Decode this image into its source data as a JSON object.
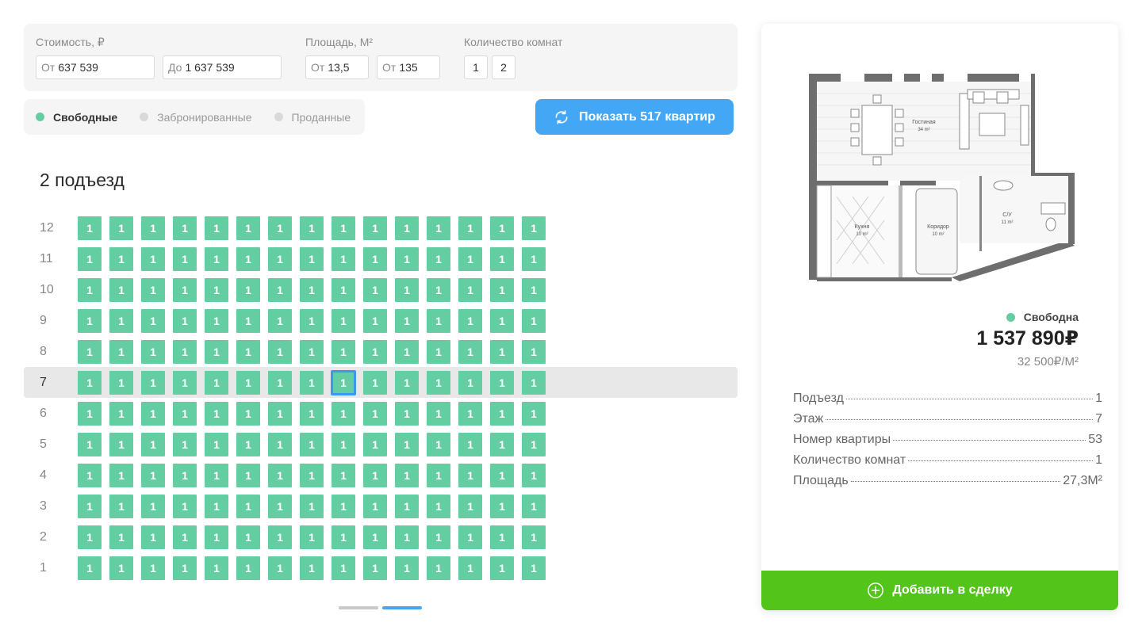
{
  "filters": {
    "price": {
      "label": "Стоимость, ₽",
      "from_prefix": "От",
      "from_value": "637 539",
      "to_prefix": "До",
      "to_value": "1 637 539"
    },
    "area": {
      "label": "Площадь, М²",
      "from_prefix": "От",
      "from_value": "13,5",
      "to_prefix": "От",
      "to_value": "135"
    },
    "rooms": {
      "label": "Количество комнат",
      "options": [
        "1",
        "2"
      ]
    }
  },
  "status_legend": [
    {
      "label": "Свободные",
      "color": "#64cda2",
      "active": true
    },
    {
      "label": "Забронированные",
      "color": "#d9d9d9",
      "active": false
    },
    {
      "label": "Проданные",
      "color": "#d9d9d9",
      "active": false
    }
  ],
  "show_button": {
    "label": "Показать 517 квартир",
    "icon": "refresh-icon"
  },
  "section": {
    "title": "2 подъезд"
  },
  "grid": {
    "floors": [
      "12",
      "11",
      "10",
      "9",
      "8",
      "7",
      "6",
      "5",
      "4",
      "3",
      "2",
      "1"
    ],
    "selected_floor": "7",
    "selected_column": 9,
    "cells_per_floor": 15,
    "cell_label": "1",
    "cell_color": "#64cda2"
  },
  "pager": {
    "pages": 2,
    "active": 2
  },
  "apartment": {
    "status": "Свободна",
    "status_color": "#64cda2",
    "price": "1 537 890₽",
    "price_per_m2": "32 500₽/М²",
    "plan_labels": {
      "living": "Гостиная",
      "living_area": "34 m²",
      "kitchen": "Кухня",
      "kitchen_area": "10 m²",
      "corridor": "Коридор",
      "corridor_area": "10 m²",
      "bath": "С/У",
      "bath_area": "11 m²"
    },
    "specs": [
      {
        "key": "Подъезд",
        "value": "1"
      },
      {
        "key": "Этаж",
        "value": "7"
      },
      {
        "key": "Номер квартиры",
        "value": "53"
      },
      {
        "key": "Количество комнат",
        "value": "1"
      },
      {
        "key": "Площадь",
        "value": "27,3М²"
      }
    ],
    "add_button": {
      "label": "Добавить в сделку",
      "icon": "plus-circle-icon"
    }
  },
  "colors": {
    "accent_blue": "#43a7f5",
    "accent_green": "#52c41a",
    "available": "#64cda2"
  }
}
